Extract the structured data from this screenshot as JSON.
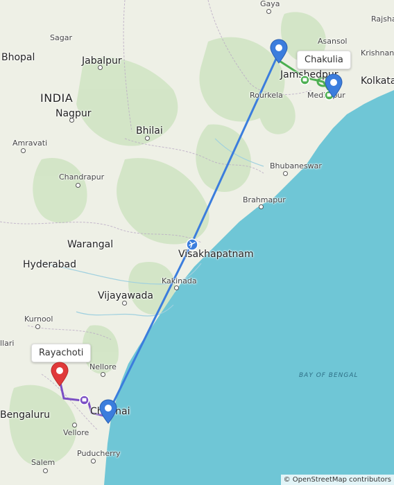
{
  "map": {
    "country_label": "INDIA",
    "sea_label": "BAY OF BENGAL",
    "attribution": "© OpenStreetMap contributors",
    "colors": {
      "land": "#eef0e6",
      "sea": "#6fc6d6",
      "forest": "#cfe4c2",
      "flight_route": "#3b7ddd",
      "road_route_origin": "#4caf50",
      "road_route_dest": "#7b4fc4",
      "pin_blue": "#3b7ddd",
      "pin_red": "#e03a3a"
    },
    "places": {
      "gaya": "Gaya",
      "rajshahi": "Rajsha",
      "sagar": "Sagar",
      "asansol": "Asansol",
      "bhopal": "Bhopal",
      "jabalpur": "Jabalpur",
      "krishnanagar": "Krishnana",
      "jamshedpur": "Jamshedpur",
      "kolkata": "Kolkata",
      "rourkela": "Rourkela",
      "medinipur": "Medinipur",
      "nagpur": "Nagpur",
      "bhilai": "Bhilai",
      "amravati": "Amravati",
      "bhubaneswar": "Bhubaneswar",
      "chandrapur": "Chandrapur",
      "brahmapur": "Brahmapur",
      "warangal": "Warangal",
      "visakhapatnam": "Visakhapatnam",
      "hyderabad": "Hyderabad",
      "kakinada": "Kakinada",
      "vijayawada": "Vijayawada",
      "kurnool": "Kurnool",
      "bellary": "llari",
      "nellore": "Nellore",
      "bengaluru": "Bengaluru",
      "chennai": "Chennai",
      "vellore": "Vellore",
      "puducherry": "Puducherry",
      "salem": "Salem"
    },
    "callouts": {
      "origin": "Chakulia",
      "destination": "Rayachoti"
    }
  }
}
